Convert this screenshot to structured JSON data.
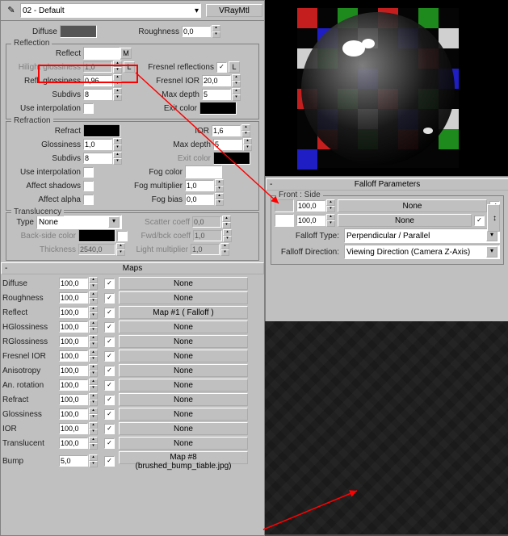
{
  "topbar": {
    "material": "02 - Default",
    "type_btn": "VRayMtl"
  },
  "basic": {
    "diffuse_label": "Diffuse",
    "roughness_label": "Roughness",
    "roughness": "0,0",
    "diffuse_color": "#555555"
  },
  "reflection": {
    "title": "Reflection",
    "reflect_label": "Reflect",
    "reflect_color": "#ffffff",
    "m_btn": "M",
    "l_btn": "L",
    "hilight_label": "Hilight glossiness",
    "hilight": "1,0",
    "refl_gloss_label": "Refl. glossiness",
    "refl_gloss": "0,96",
    "subdivs_label": "Subdivs",
    "subdivs": "8",
    "use_interp_label": "Use interpolation",
    "fresnel_label": "Fresnel reflections",
    "fresnel_ior_label": "Fresnel IOR",
    "fresnel_ior": "20,0",
    "max_depth_label": "Max depth",
    "max_depth": "5",
    "exit_color_label": "Exit color",
    "exit_color": "#000000"
  },
  "refraction": {
    "title": "Refraction",
    "refract_label": "Refract",
    "refract_color": "#000000",
    "gloss_label": "Glossiness",
    "gloss": "1,0",
    "subdivs_label": "Subdivs",
    "subdivs": "8",
    "use_interp_label": "Use interpolation",
    "affect_shadows_label": "Affect shadows",
    "affect_alpha_label": "Affect alpha",
    "ior_label": "IOR",
    "ior": "1,6",
    "max_depth_label": "Max depth",
    "max_depth": "5",
    "exit_color_label": "Exit color",
    "exit_color": "#000000",
    "fog_color_label": "Fog color",
    "fog_color": "#ffffff",
    "fog_mult_label": "Fog multiplier",
    "fog_mult": "1,0",
    "fog_bias_label": "Fog bias",
    "fog_bias": "0,0"
  },
  "translucency": {
    "title": "Translucency",
    "type_label": "Type",
    "type_value": "None",
    "backside_label": "Back-side color",
    "backside_color": "#000000",
    "thickness_label": "Thickness",
    "thickness": "2540,0",
    "scatter_label": "Scatter coeff",
    "scatter": "0,0",
    "fwdbck_label": "Fwd/bck coeff",
    "fwdbck": "1,0",
    "light_mult_label": "Light multiplier",
    "light_mult": "1,0"
  },
  "maps": {
    "title": "Maps",
    "rows": [
      {
        "name": "Diffuse",
        "amt": "100,0",
        "on": true,
        "map": "None",
        "interactable": true
      },
      {
        "name": "Roughness",
        "amt": "100,0",
        "on": true,
        "map": "None",
        "interactable": true
      },
      {
        "name": "Reflect",
        "amt": "100,0",
        "on": true,
        "map": "Map #1  ( Falloff )",
        "interactable": true
      },
      {
        "name": "HGlossiness",
        "amt": "100,0",
        "on": true,
        "map": "None",
        "interactable": true
      },
      {
        "name": "RGlossiness",
        "amt": "100,0",
        "on": true,
        "map": "None",
        "interactable": true
      },
      {
        "name": "Fresnel IOR",
        "amt": "100,0",
        "on": true,
        "map": "None",
        "interactable": true
      },
      {
        "name": "Anisotropy",
        "amt": "100,0",
        "on": true,
        "map": "None",
        "interactable": true
      },
      {
        "name": "An. rotation",
        "amt": "100,0",
        "on": true,
        "map": "None",
        "interactable": true
      },
      {
        "name": "Refract",
        "amt": "100,0",
        "on": true,
        "map": "None",
        "interactable": true
      },
      {
        "name": "Glossiness",
        "amt": "100,0",
        "on": true,
        "map": "None",
        "interactable": true
      },
      {
        "name": "IOR",
        "amt": "100,0",
        "on": true,
        "map": "None",
        "interactable": true
      },
      {
        "name": "Translucent",
        "amt": "100,0",
        "on": true,
        "map": "None",
        "interactable": true
      },
      {
        "name": "Bump",
        "amt": "5,0",
        "on": true,
        "map": "Map #8 (brushed_bump_tiable.jpg)",
        "interactable": true
      }
    ]
  },
  "falloff": {
    "title": "Falloff Parameters",
    "front_side": "Front : Side",
    "row1": {
      "color": "#bbbbbb",
      "amt": "100,0",
      "map": "None",
      "on": true
    },
    "row2": {
      "color": "#ffffff",
      "amt": "100,0",
      "map": "None",
      "on": true
    },
    "swap": "↕",
    "type_label": "Falloff Type:",
    "type_value": "Perpendicular / Parallel",
    "dir_label": "Falloff Direction:",
    "dir_value": "Viewing Direction (Camera Z-Axis)"
  }
}
